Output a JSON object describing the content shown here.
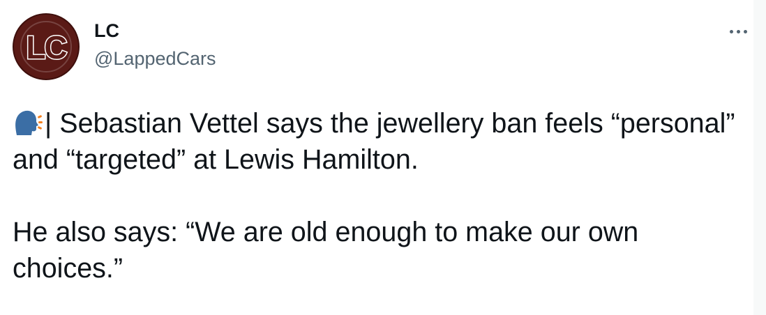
{
  "author": {
    "avatar_text": "LC",
    "display_name": "LC",
    "handle": "@LappedCars"
  },
  "tweet": {
    "line1_rest": "| Sebastian Vettel says the jewellery ban feels “personal” and “targeted” at Lewis Hamilton.",
    "paragraph2": "He also says: “We are old enough to make our own choices.”"
  },
  "icons": {
    "leading": "speaking-head-icon",
    "menu": "more-icon"
  },
  "colors": {
    "text": "#0f1419",
    "secondary": "#536471",
    "avatar_bg": "#5a1a16",
    "icon_blue": "#3b6ea5",
    "icon_orange": "#f5811f"
  }
}
